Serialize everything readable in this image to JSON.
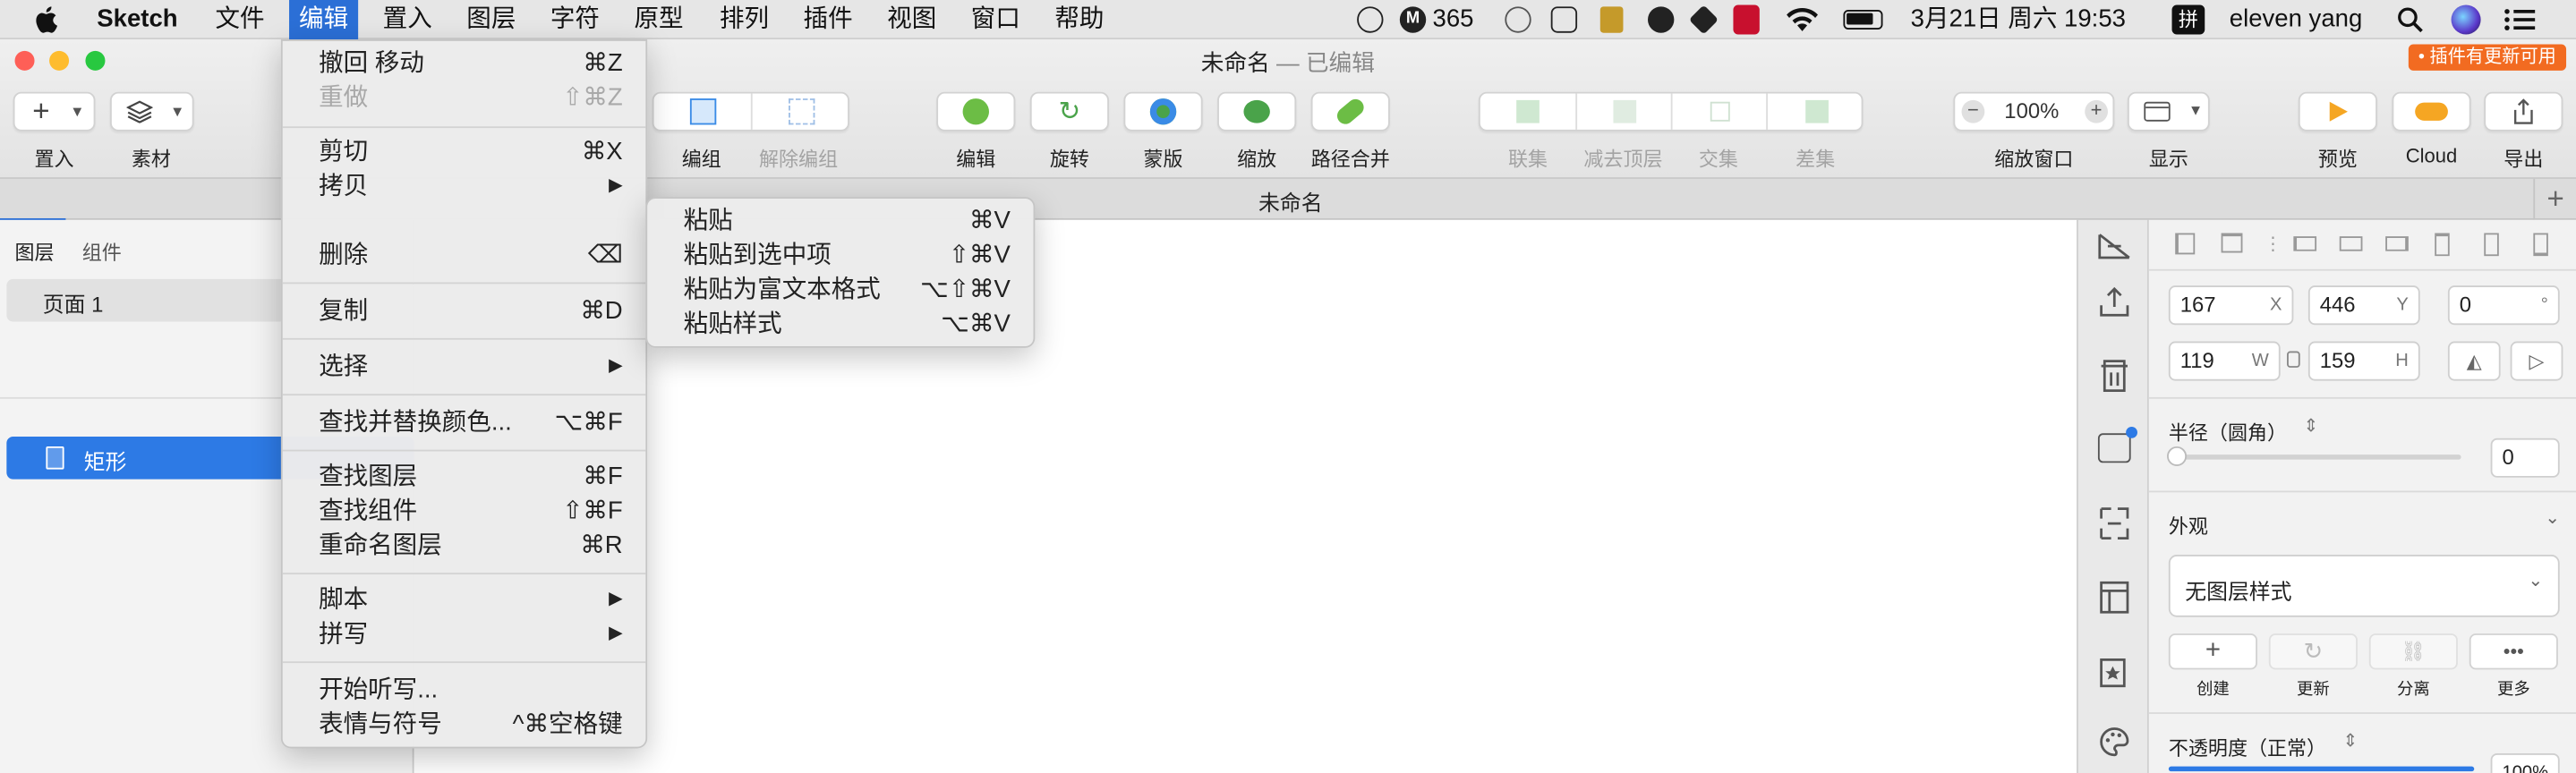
{
  "menubar": {
    "app_name": "Sketch",
    "items": [
      "文件",
      "编辑",
      "置入",
      "图层",
      "字符",
      "原型",
      "排列",
      "插件",
      "视图",
      "窗口",
      "帮助"
    ],
    "status": {
      "badge_number": "365",
      "datetime": "3月21日 周六 19:53",
      "input_method": "拼",
      "user": "eleven yang"
    }
  },
  "window": {
    "title": "未命名",
    "title_suffix": "— 已编辑",
    "update_badge": "• 插件有更新可用"
  },
  "toolbar": {
    "insert": "置入",
    "assets": "素材",
    "group": "编组",
    "ungroup": "解除编组",
    "edit": "编辑",
    "rotate": "旋转",
    "mask": "蒙版",
    "scale": "缩放",
    "flatten": "路径合并",
    "union": "联集",
    "subtract": "减去顶层",
    "intersect": "交集",
    "difference": "差集",
    "zoom_value": "100%",
    "zoom_label": "缩放窗口",
    "view": "显示",
    "preview": "预览",
    "cloud": "Cloud",
    "export": "导出"
  },
  "tab": {
    "title": "未命名"
  },
  "left_panel": {
    "tabs": [
      "图层",
      "组件"
    ],
    "page": "页面 1",
    "layer": "矩形"
  },
  "inspector": {
    "x": "167",
    "x_suffix": "X",
    "y": "446",
    "y_suffix": "Y",
    "rotation": "0",
    "rotation_suffix": "°",
    "w": "119",
    "w_suffix": "W",
    "h": "159",
    "h_suffix": "H",
    "radius_label": "半径（圆角）",
    "radius_value": "0",
    "appearance_label": "外观",
    "style_select": "无图层样式",
    "style_actions": [
      "创建",
      "更新",
      "分离",
      "更多"
    ],
    "opacity_label": "不透明度（正常）",
    "opacity_value": "100%"
  },
  "edit_menu": {
    "items": [
      {
        "label": "撤回 移动",
        "shortcut": "⌘Z"
      },
      {
        "label": "重做",
        "shortcut": "⇧⌘Z",
        "disabled": true
      },
      {
        "label": "剪切",
        "shortcut": "⌘X"
      },
      {
        "label": "拷贝",
        "shortcut": "▶"
      },
      {
        "label": "删除",
        "shortcut": "⌫"
      },
      {
        "label": "复制",
        "shortcut": "⌘D"
      },
      {
        "label": "选择",
        "shortcut": "▶"
      },
      {
        "label": "查找并替换颜色...",
        "shortcut": "⌥⌘F"
      },
      {
        "label": "查找图层",
        "shortcut": "⌘F"
      },
      {
        "label": "查找组件",
        "shortcut": "⇧⌘F"
      },
      {
        "label": "重命名图层",
        "shortcut": "⌘R"
      },
      {
        "label": "脚本",
        "shortcut": "▶"
      },
      {
        "label": "拼写",
        "shortcut": "▶"
      },
      {
        "label": "开始听写...",
        "shortcut": ""
      },
      {
        "label": "表情与符号",
        "shortcut": "^⌘空格键"
      }
    ]
  },
  "paste_submenu": {
    "items": [
      {
        "label": "粘贴",
        "shortcut": "⌘V"
      },
      {
        "label": "粘贴到选中项",
        "shortcut": "⇧⌘V"
      },
      {
        "label": "粘贴为富文本格式",
        "shortcut": "⌥⇧⌘V"
      },
      {
        "label": "粘贴样式",
        "shortcut": "⌥⌘V"
      }
    ]
  },
  "colors": {
    "accent": "#2b6fd6",
    "selection": "#2d7ae5",
    "update_badge": "#f26b21"
  }
}
